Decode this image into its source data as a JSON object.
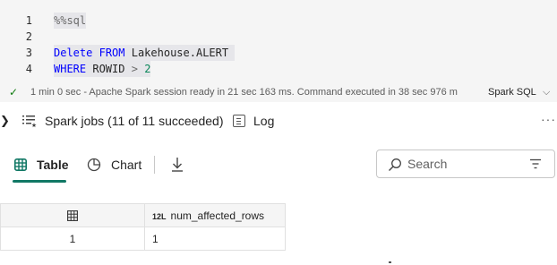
{
  "code": {
    "lines": [
      {
        "number": "1",
        "magic": "%%sql"
      },
      {
        "number": "2"
      },
      {
        "number": "3",
        "kw1": "Delete",
        "kw2": "FROM",
        "rest": "Lakehouse.ALERT"
      },
      {
        "number": "4",
        "kw1": "WHERE",
        "ident": "ROWID",
        "op": ">",
        "value": "2"
      }
    ]
  },
  "status": {
    "icon": "check-icon",
    "duration": "1 min 0 sec",
    "message": "- Apache Spark session ready in 21 sec 163 ms. Command executed in 38 sec 976 m",
    "language": "Spark SQL",
    "color_success": "#107c10"
  },
  "jobs": {
    "label": "Spark jobs (11 of 11 succeeded)",
    "log_label": "Log"
  },
  "tabs": {
    "table_label": "Table",
    "chart_label": "Chart",
    "accent": "#117865"
  },
  "search": {
    "placeholder": "Search",
    "value": ""
  },
  "result": {
    "columns": [
      {
        "type_tag": "12L",
        "name": "num_affected_rows"
      }
    ],
    "rows": [
      {
        "index": "1",
        "values": [
          "1"
        ]
      }
    ]
  }
}
